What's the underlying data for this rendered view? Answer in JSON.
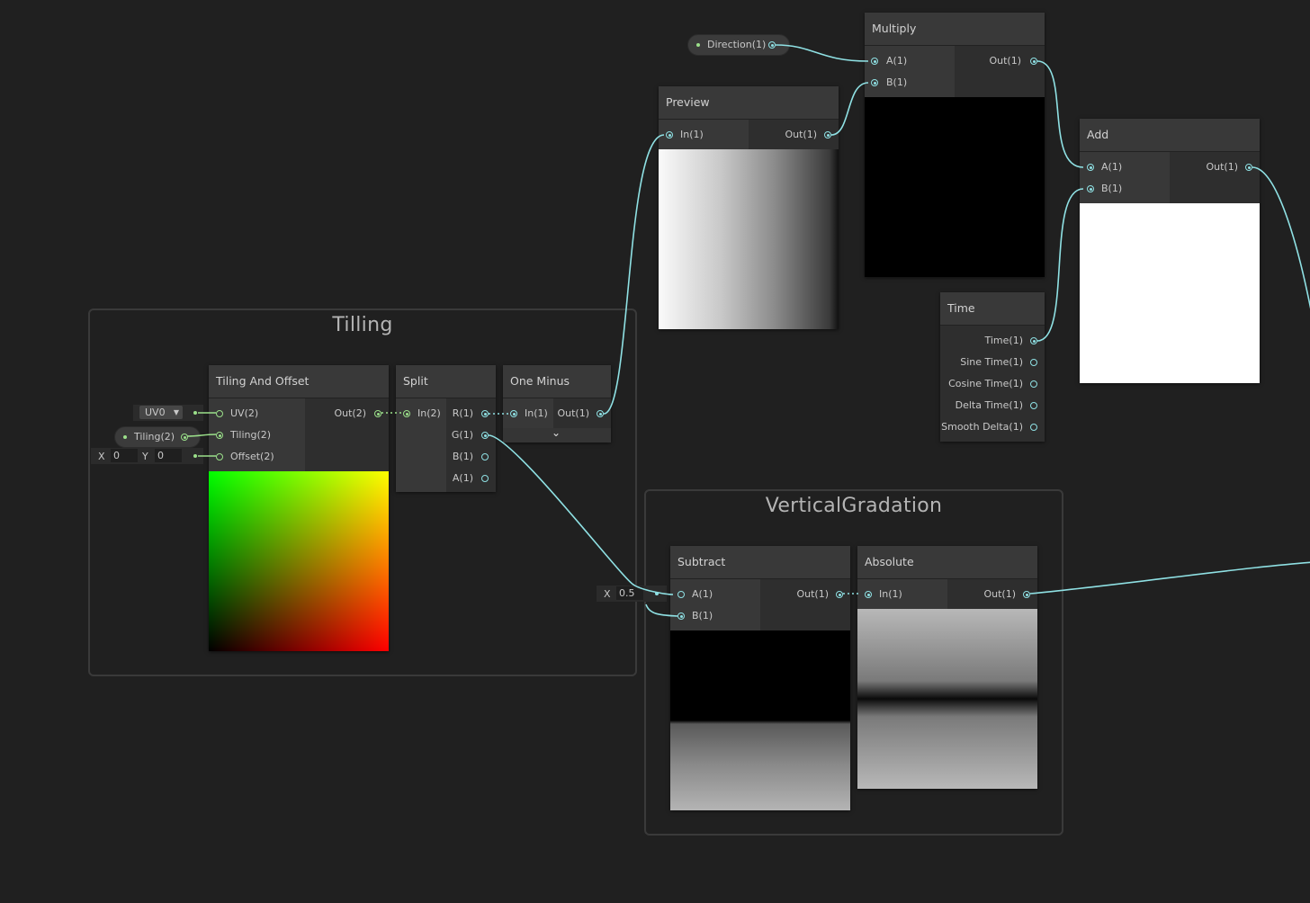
{
  "groups": {
    "tilling": {
      "title": "Tilling"
    },
    "vertical": {
      "title": "VerticalGradation"
    }
  },
  "nodes": {
    "preview": {
      "title": "Preview",
      "in": "In(1)",
      "out": "Out(1)"
    },
    "multiply": {
      "title": "Multiply",
      "in_a": "A(1)",
      "in_b": "B(1)",
      "out": "Out(1)"
    },
    "add": {
      "title": "Add",
      "in_a": "A(1)",
      "in_b": "B(1)",
      "out": "Out(1)"
    },
    "time": {
      "title": "Time",
      "outputs": [
        "Time(1)",
        "Sine Time(1)",
        "Cosine Time(1)",
        "Delta Time(1)",
        "Smooth Delta(1)"
      ]
    },
    "tiling_offset": {
      "title": "Tiling And Offset",
      "in_uv": "UV(2)",
      "in_tiling": "Tiling(2)",
      "in_offset": "Offset(2)",
      "out": "Out(2)"
    },
    "split": {
      "title": "Split",
      "in": "In(2)",
      "outputs": [
        "R(1)",
        "G(1)",
        "B(1)",
        "A(1)"
      ]
    },
    "one_minus": {
      "title": "One Minus",
      "in": "In(1)",
      "out": "Out(1)"
    },
    "subtract": {
      "title": "Subtract",
      "in_a": "A(1)",
      "in_b": "B(1)",
      "out": "Out(1)"
    },
    "absolute": {
      "title": "Absolute",
      "in": "In(1)",
      "out": "Out(1)"
    }
  },
  "properties": {
    "direction": "Direction(1)",
    "tiling": "Tiling(2)"
  },
  "inputs": {
    "uv_channel": "UV0",
    "offset_x_label": "X",
    "offset_x": "0",
    "offset_y_label": "Y",
    "offset_y": "0",
    "subtract_b_label": "X",
    "subtract_b": "0.5"
  },
  "colors": {
    "wire": "#8fe1e4",
    "vector2_port": "#9be08a",
    "background": "#202020"
  }
}
